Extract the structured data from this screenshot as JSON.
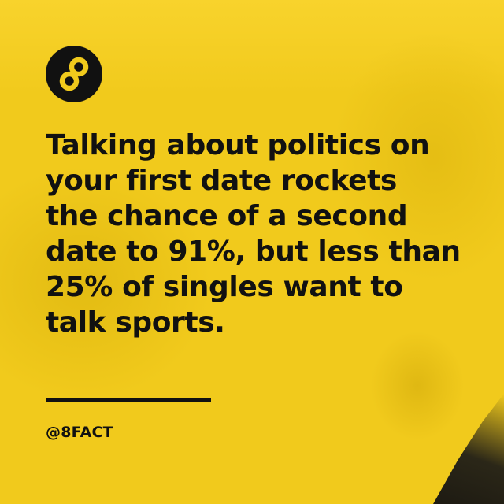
{
  "brand": {
    "logo_icon": "infinity-eight-icon",
    "logo_background": "#111111",
    "logo_foreground": "#f1ca1c",
    "handle": "@8FACT"
  },
  "post": {
    "headline": "Talking about politics on\nyour first date rockets\nthe chance of a second\ndate to 91%, but less than\n25% of singles want to\ntalk sports."
  },
  "colors": {
    "background": "#f1ca1c",
    "text": "#111111",
    "divider": "#111111"
  }
}
